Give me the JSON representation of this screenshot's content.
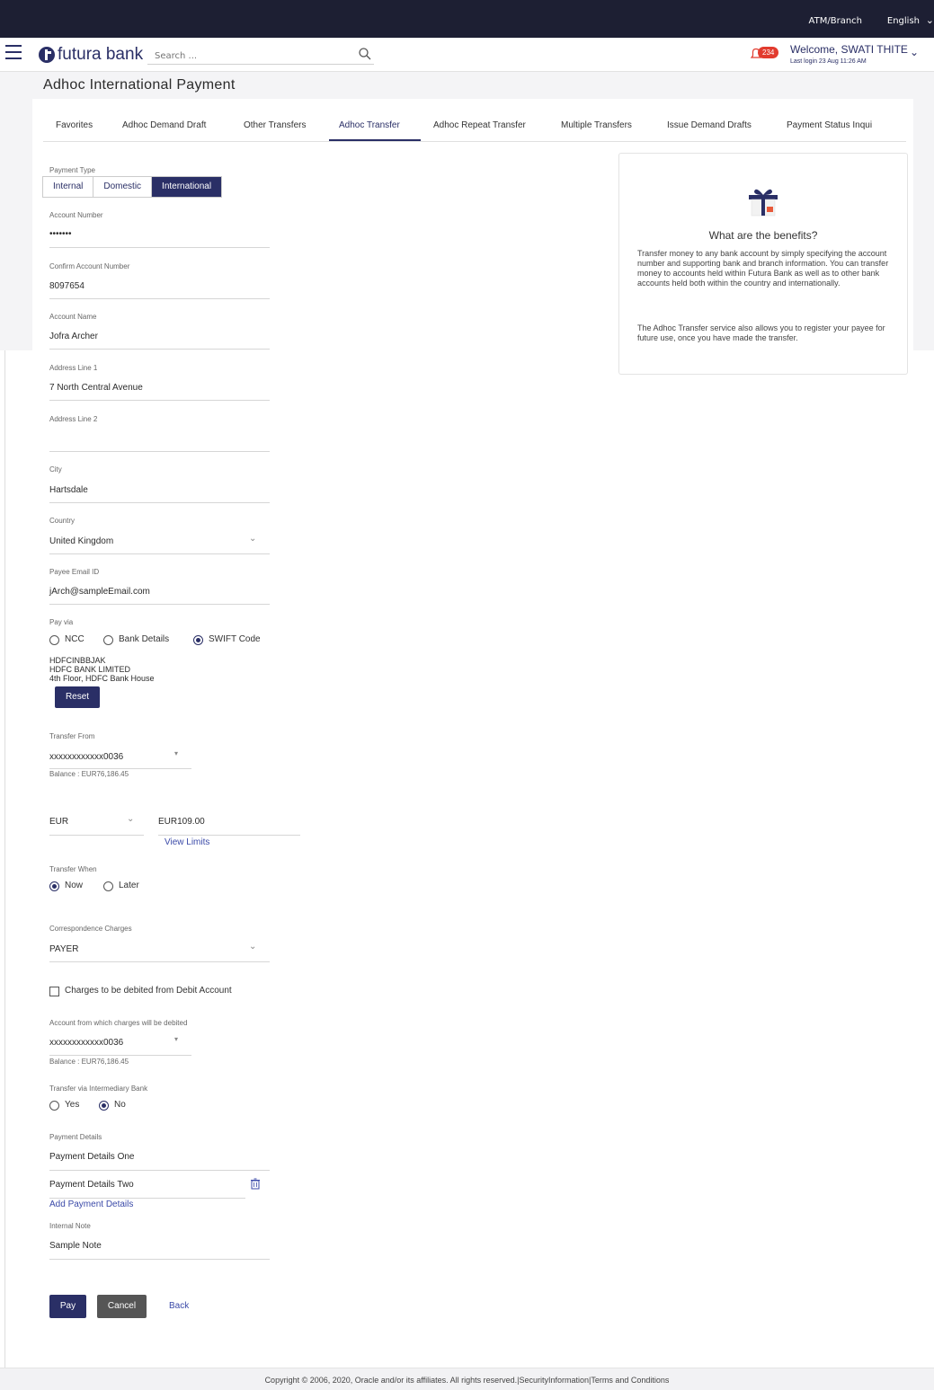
{
  "topbar": {
    "atm_branch": "ATM/Branch",
    "language": "English"
  },
  "header": {
    "logo_text": "futura bank",
    "search_placeholder": "Search ...",
    "notification_count": "234",
    "welcome": "Welcome, SWATI THITE",
    "last_login": "Last login 23 Aug 11:26 AM"
  },
  "page": {
    "title": "Adhoc International Payment"
  },
  "tabs": [
    "Favorites",
    "Adhoc Demand Draft",
    "Other Transfers",
    "Adhoc Transfer",
    "Adhoc Repeat Transfer",
    "Multiple Transfers",
    "Issue Demand Drafts",
    "Payment Status Inqui"
  ],
  "form": {
    "payment_type": {
      "label": "Payment Type",
      "options": [
        "Internal",
        "Domestic",
        "International"
      ],
      "selected": "International"
    },
    "account_number": {
      "label": "Account Number",
      "value": "•••••••"
    },
    "confirm_account_number": {
      "label": "Confirm Account Number",
      "value": "8097654"
    },
    "account_name": {
      "label": "Account Name",
      "value": "Jofra Archer"
    },
    "address_line1": {
      "label": "Address Line 1",
      "value": "7 North Central Avenue"
    },
    "address_line2": {
      "label": "Address Line 2",
      "value": ""
    },
    "city": {
      "label": "City",
      "value": "Hartsdale"
    },
    "country": {
      "label": "Country",
      "value": "United Kingdom"
    },
    "payee_email": {
      "label": "Payee Email ID",
      "value": "jArch@sampleEmail.com"
    },
    "pay_via": {
      "label": "Pay via",
      "options": [
        "NCC",
        "Bank Details",
        "SWIFT Code"
      ],
      "selected": "SWIFT Code",
      "swift_code": "HDFCINBBJAK",
      "bank_name": "HDFC BANK LIMITED",
      "bank_address": "4th Floor, HDFC Bank House",
      "reset_label": "Reset"
    },
    "transfer_from": {
      "label": "Transfer From",
      "value": "xxxxxxxxxxxx0036",
      "balance": "Balance : EUR76,186.45"
    },
    "amount": {
      "currency": "EUR",
      "value": "EUR109.00",
      "view_limits": "View Limits"
    },
    "transfer_when": {
      "label": "Transfer When",
      "options": [
        "Now",
        "Later"
      ],
      "selected": "Now"
    },
    "correspondence_charges": {
      "label": "Correspondence Charges",
      "value": "PAYER"
    },
    "charges_debited_checkbox": "Charges to be debited from Debit Account",
    "charges_account": {
      "label": "Account from which charges will be debited",
      "value": "xxxxxxxxxxxx0036",
      "balance": "Balance : EUR76,186.45"
    },
    "intermediary_bank": {
      "label": "Transfer via Intermediary Bank",
      "options": [
        "Yes",
        "No"
      ],
      "selected": "No"
    },
    "payment_details": {
      "label": "Payment Details",
      "line1": "Payment Details One",
      "line2": "Payment Details Two",
      "add_label": "Add Payment Details"
    },
    "internal_note": {
      "label": "Internal Note",
      "value": "Sample Note"
    }
  },
  "actions": {
    "pay": "Pay",
    "cancel": "Cancel",
    "back": "Back"
  },
  "benefits": {
    "title": "What are the benefits?",
    "para1": "Transfer money to any bank account by simply specifying the account number and supporting bank and branch information. You can transfer money to accounts held within Futura Bank as well as to other bank accounts held both within the country and internationally.",
    "para2": "The Adhoc Transfer service also allows you to register your payee for future use, once you have made the transfer."
  },
  "footer": {
    "text": "Copyright © 2006, 2020, Oracle and/or its affiliates. All rights reserved.|SecurityInformation|Terms and Conditions"
  },
  "colors": {
    "primary": "#2a2f66",
    "topbar": "#1d1f33",
    "badge": "#e23b2e"
  },
  "icons": [
    "hamburger-icon",
    "logo-icon",
    "search-icon",
    "bell-icon",
    "chevron-down-icon",
    "gift-icon",
    "trash-icon"
  ]
}
